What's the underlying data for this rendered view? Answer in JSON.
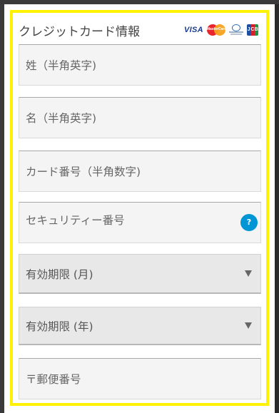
{
  "form": {
    "title": "クレジットカード情報",
    "card_brands": [
      "VISA",
      "MasterCard",
      "Diners Club",
      "JCB"
    ],
    "last_name_placeholder": "姓（半角英字)",
    "first_name_placeholder": "名（半角英字)",
    "card_number_placeholder": "カード番号（半角数字)",
    "security_code_placeholder": "セキュリティー番号",
    "help_label": "?",
    "expiry_month_selected": "有効期限 (月)",
    "expiry_year_selected": "有効期限 (年)",
    "postal_code_placeholder": "〒郵便番号"
  },
  "colors": {
    "highlight_border": "#fff200",
    "help_button": "#0096d6",
    "background": "#3a3a3a"
  }
}
